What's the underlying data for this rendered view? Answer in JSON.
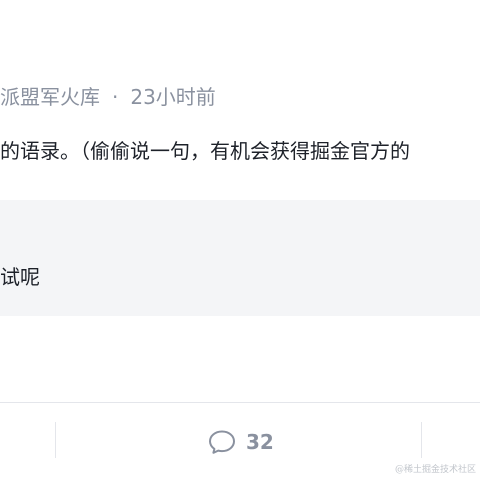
{
  "post": {
    "meta": {
      "author": "派盟军火库",
      "separator": "·",
      "time": "23小时前"
    },
    "content_text": "的语录。（偷偷说一句，有机会获得掘金官方的",
    "quote_text": "试呢"
  },
  "actions": {
    "comment_count": "32",
    "comment_icon": "speech-bubble-icon"
  },
  "watermark": "@稀土掘金技术社区",
  "colors": {
    "meta_text": "#8a919f",
    "body_text": "#1d2129",
    "quote_background": "#f4f5f7",
    "divider": "#e4e6eb"
  }
}
